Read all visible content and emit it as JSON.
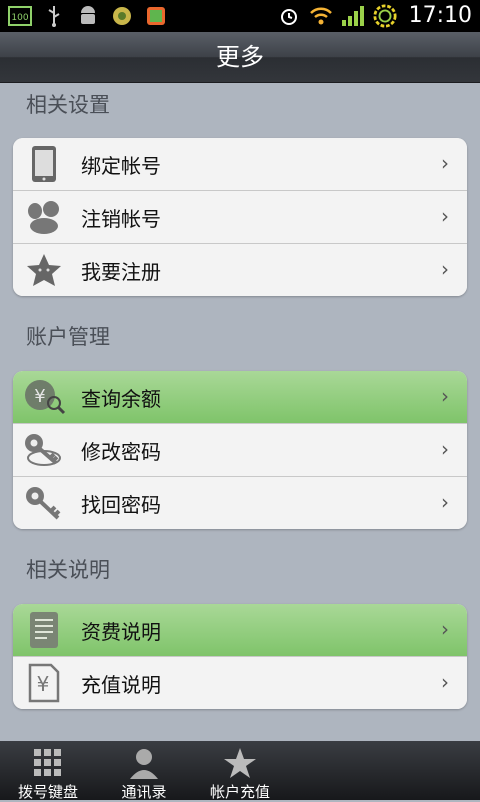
{
  "status_bar": {
    "battery_text": "100",
    "time": "17:10",
    "icons": [
      "battery-icon",
      "usb-icon",
      "android-icon",
      "app-icon",
      "colorful-app-icon",
      "alarm-icon",
      "wifi-icon",
      "signal-icon",
      "sync-icon"
    ]
  },
  "header": {
    "title": "更多"
  },
  "sections": [
    {
      "label": "相关设置",
      "items": [
        {
          "label": "绑定帐号",
          "icon": "phone-icon",
          "chevron": "›"
        },
        {
          "label": "注销帐号",
          "icon": "paw-icon",
          "chevron": "›"
        },
        {
          "label": "我要注册",
          "icon": "star-icon",
          "chevron": "›"
        }
      ]
    },
    {
      "label": "账户管理",
      "items": [
        {
          "label": "查询余额",
          "icon": "yen-search-icon",
          "chevron": "›"
        },
        {
          "label": "修改密码",
          "icon": "key-icon",
          "chevron": "›"
        },
        {
          "label": "找回密码",
          "icon": "key-find-icon",
          "chevron": "›"
        }
      ]
    },
    {
      "label": "相关说明",
      "items": [
        {
          "label": "资费说明",
          "icon": "document-icon",
          "chevron": "›"
        },
        {
          "label": "充值说明",
          "icon": "yen-doc-icon",
          "chevron": "›"
        }
      ]
    }
  ],
  "tabbar": {
    "tabs": [
      {
        "label": "拨号键盘",
        "icon": "keypad-icon"
      },
      {
        "label": "通讯录",
        "icon": "contact-icon"
      },
      {
        "label": "帐户充值",
        "icon": "star-icon"
      }
    ]
  },
  "colors": {
    "background": "#aeb5bf",
    "highlight": "#8fcb78",
    "title_bar": "#3d4148"
  }
}
